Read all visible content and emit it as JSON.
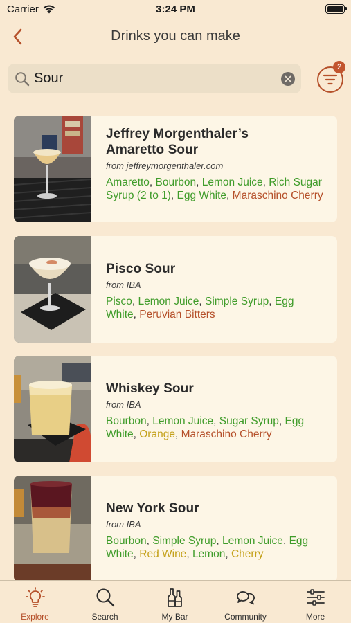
{
  "status": {
    "carrier": "Carrier",
    "time": "3:24 PM"
  },
  "nav": {
    "title": "Drinks you can make"
  },
  "search": {
    "value": "Sour",
    "filter_badge": "2"
  },
  "colors": {
    "accent": "#b5502a",
    "have": "#3f9c2a",
    "missing": "#b5502a",
    "substitute": "#c4a11a",
    "background": "#f9e9d2",
    "card": "#fdf6e6"
  },
  "drinks": [
    {
      "name_line1": "Jeffrey Morgenthaler’s",
      "name_line2": "Amaretto Sour",
      "from_prefix": "from",
      "source": "jeffreymorgenthaler.com",
      "ingredients": [
        {
          "text": "Amaretto",
          "status": "have"
        },
        {
          "text": "Bourbon",
          "status": "have"
        },
        {
          "text": "Lemon Juice",
          "status": "have"
        },
        {
          "text": "Rich Sugar Syrup (2 to 1)",
          "status": "have"
        },
        {
          "text": "Egg White",
          "status": "have"
        },
        {
          "text": "Maraschino Cherry",
          "status": "missing"
        }
      ]
    },
    {
      "name_line1": "Pisco Sour",
      "from_prefix": "from",
      "source": "IBA",
      "ingredients": [
        {
          "text": "Pisco",
          "status": "have"
        },
        {
          "text": "Lemon Juice",
          "status": "have"
        },
        {
          "text": "Simple Syrup",
          "status": "have"
        },
        {
          "text": "Egg White",
          "status": "have"
        },
        {
          "text": "Peruvian Bitters",
          "status": "missing"
        }
      ]
    },
    {
      "name_line1": "Whiskey Sour",
      "from_prefix": "from",
      "source": "IBA",
      "ingredients": [
        {
          "text": "Bourbon",
          "status": "have"
        },
        {
          "text": "Lemon Juice",
          "status": "have"
        },
        {
          "text": "Sugar Syrup",
          "status": "have"
        },
        {
          "text": "Egg White",
          "status": "have"
        },
        {
          "text": "Orange",
          "status": "sub"
        },
        {
          "text": "Maraschino Cherry",
          "status": "missing"
        }
      ]
    },
    {
      "name_line1": "New York Sour",
      "from_prefix": "from",
      "source": "IBA",
      "ingredients": [
        {
          "text": "Bourbon",
          "status": "have"
        },
        {
          "text": "Simple Syrup",
          "status": "have"
        },
        {
          "text": "Lemon Juice",
          "status": "have"
        },
        {
          "text": "Egg White",
          "status": "have"
        },
        {
          "text": "Red Wine",
          "status": "sub"
        },
        {
          "text": "Lemon",
          "status": "have"
        },
        {
          "text": "Cherry",
          "status": "sub"
        }
      ]
    }
  ],
  "tabs": [
    {
      "label": "Explore",
      "icon": "lightbulb-icon",
      "active": true
    },
    {
      "label": "Search",
      "icon": "search-icon",
      "active": false
    },
    {
      "label": "My Bar",
      "icon": "bottles-icon",
      "active": false
    },
    {
      "label": "Community",
      "icon": "chat-bubbles-icon",
      "active": false
    },
    {
      "label": "More",
      "icon": "sliders-icon",
      "active": false
    }
  ]
}
